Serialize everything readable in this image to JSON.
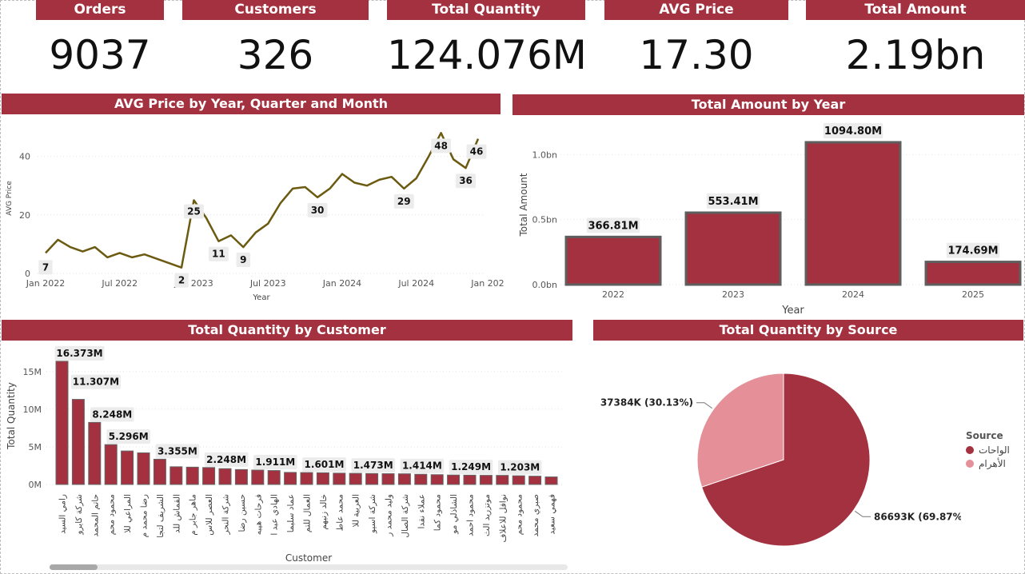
{
  "kpis": [
    {
      "label": "Orders",
      "value": "9037"
    },
    {
      "label": "Customers",
      "value": "326"
    },
    {
      "label": "Total Quantity",
      "value": "124.076M"
    },
    {
      "label": "AVG Price",
      "value": "17.30"
    },
    {
      "label": "Total Amount",
      "value": "2.19bn"
    }
  ],
  "colors": {
    "brand": "#a4313f",
    "line": "#6b5a10",
    "pie_light": "#e58f98",
    "pie_dark": "#a4313f"
  },
  "panels": {
    "avg_price_title": "AVG Price by Year, Quarter and Month",
    "amount_title": "Total Amount by Year",
    "customer_title": "Total Quantity by Customer",
    "source_title": "Total Quantity by Source"
  },
  "chart_data": [
    {
      "type": "line",
      "title": "AVG Price by Year, Quarter and Month",
      "xlabel": "Year",
      "ylabel": "AVG Price",
      "ylim": [
        0,
        50
      ],
      "yticks": [
        "0",
        "20",
        "40"
      ],
      "xticks": [
        "Jan 2022",
        "Jul 2022",
        "Jan 2023",
        "Jul 2023",
        "Jan 2024",
        "Jul 2024",
        "Jan 2025"
      ],
      "series": [
        {
          "values": [
            7,
            11.5,
            9,
            7.5,
            9,
            5.5,
            7,
            5.5,
            6.5,
            5,
            3.5,
            2,
            25,
            19,
            11,
            13,
            9,
            14,
            17,
            24,
            29,
            29.5,
            26,
            29,
            34,
            31,
            30,
            32,
            33,
            29,
            32.5,
            40,
            48,
            39,
            36,
            46
          ]
        }
      ],
      "data_labels": [
        {
          "index": 0,
          "text": "7"
        },
        {
          "index": 11,
          "text": "2"
        },
        {
          "index": 12,
          "text": "25"
        },
        {
          "index": 14,
          "text": "11"
        },
        {
          "index": 16,
          "text": "9"
        },
        {
          "index": 22,
          "text": "30"
        },
        {
          "index": 29,
          "text": "29"
        },
        {
          "index": 32,
          "text": "48"
        },
        {
          "index": 34,
          "text": "36"
        },
        {
          "index": 35,
          "text": "46"
        }
      ]
    },
    {
      "type": "bar",
      "title": "Total Amount by Year",
      "xlabel": "Year",
      "ylabel": "Total Amount",
      "categories": [
        "2022",
        "2023",
        "2024",
        "2025"
      ],
      "values": [
        366.81,
        553.41,
        1094.8,
        174.69
      ],
      "value_labels": [
        "366.81M",
        "553.41M",
        "1094.80M",
        "174.69M"
      ],
      "yticks": [
        "0.0bn",
        "0.5bn",
        "1.0bn"
      ],
      "ylim": [
        0,
        1150
      ]
    },
    {
      "type": "bar",
      "title": "Total Quantity by Customer",
      "xlabel": "Customer",
      "ylabel": "Total Quantity",
      "ylim": [
        0,
        17
      ],
      "yticks": [
        "0M",
        "5M",
        "10M",
        "15M"
      ],
      "categories": [
        "رامي السيد",
        "شركة كايرو",
        "حاتم المحمد",
        "محمود محم",
        "المراعي للا",
        "رضا محمد م",
        "الشريف لتجا",
        "القماش للد",
        "ماهر جابر م",
        "العصر للاس",
        "شركة النحر",
        "حسين رضا",
        "فرحات هيبه",
        "الهادي عبد ا",
        "عماد سليما",
        "العمال للتم",
        "خالد زنيهم",
        "محمد عاط",
        "العربية للا",
        "شركة اسيو",
        "وليد محمد ر",
        "شركة الصال",
        "عملاء نقدا",
        "محمود كما",
        "الشاذلي مو",
        "محمود احمد",
        "موتزريد الث",
        "نوافل للاعلاف",
        "محمود محم",
        "صبري محمد",
        "فهمي سعيد"
      ],
      "values": [
        16.373,
        11.307,
        8.248,
        5.296,
        4.45,
        4.2,
        3.355,
        2.35,
        2.3,
        2.248,
        2.1,
        1.98,
        1.911,
        1.85,
        1.601,
        1.58,
        1.55,
        1.5,
        1.473,
        1.45,
        1.43,
        1.414,
        1.35,
        1.3,
        1.249,
        1.23,
        1.21,
        1.203,
        1.15,
        1.1,
        1.0
      ],
      "data_labels": [
        {
          "index": 0,
          "text": "16.373M"
        },
        {
          "index": 1,
          "text": "11.307M"
        },
        {
          "index": 2,
          "text": "8.248M"
        },
        {
          "index": 3,
          "text": "5.296M"
        },
        {
          "index": 6,
          "text": "3.355M"
        },
        {
          "index": 9,
          "text": "2.248M"
        },
        {
          "index": 12,
          "text": "1.911M"
        },
        {
          "index": 15,
          "text": "1.601M"
        },
        {
          "index": 18,
          "text": "1.473M"
        },
        {
          "index": 21,
          "text": "1.414M"
        },
        {
          "index": 24,
          "text": "1.249M"
        },
        {
          "index": 27,
          "text": "1.203M"
        }
      ]
    },
    {
      "type": "pie",
      "title": "Total Quantity by Source",
      "legend_title": "Source",
      "legend_position": "right",
      "slices": [
        {
          "name": "الواحات",
          "value": 86693,
          "label": "86693K (69.87%)",
          "color": "#a4313f"
        },
        {
          "name": "الأهرام",
          "value": 37384,
          "label": "37384K (30.13%)",
          "color": "#e58f98"
        }
      ]
    }
  ]
}
